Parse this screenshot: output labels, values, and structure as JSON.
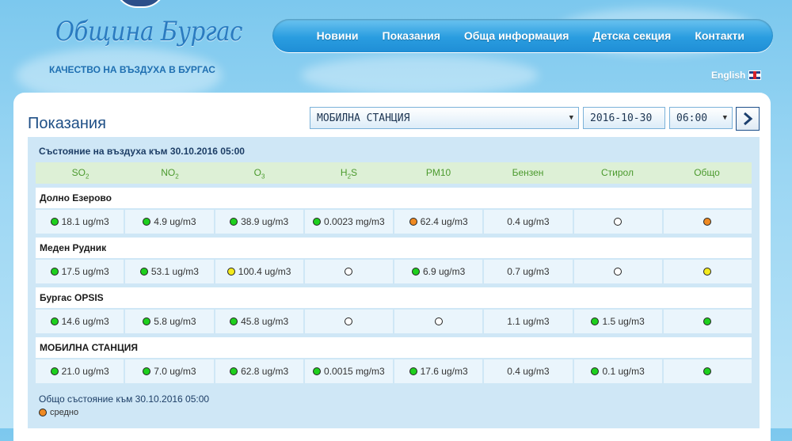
{
  "header": {
    "logo_title": "Община Бургас",
    "tagline": "КАЧЕСТВО НА ВЪЗДУХА В БУРГАС",
    "nav": [
      "Новини",
      "Показания",
      "Обща информация",
      "Детска секция",
      "Контакти"
    ],
    "language": "English"
  },
  "page": {
    "title": "Показания",
    "station_select": "МОБИЛНА СТАНЦИЯ",
    "date_value": "2016-10-30",
    "time_select": "06:00"
  },
  "table": {
    "status_heading": "Състояние на въздуха към 30.10.2016 05:00",
    "columns": [
      {
        "name": "SO",
        "sub": "2"
      },
      {
        "name": "NO",
        "sub": "2"
      },
      {
        "name": "O",
        "sub": "3"
      },
      {
        "name": "H",
        "sub": "2",
        "tail": "S"
      },
      {
        "name": "PM10",
        "sub": ""
      },
      {
        "name": "Бензен",
        "sub": ""
      },
      {
        "name": "Стирол",
        "sub": ""
      },
      {
        "name": "Общо",
        "sub": ""
      }
    ],
    "stations": [
      {
        "name": "Долно Езерово",
        "cells": [
          {
            "status": "green",
            "value": "18.1 ug/m3"
          },
          {
            "status": "green",
            "value": "4.9 ug/m3"
          },
          {
            "status": "green",
            "value": "38.9 ug/m3"
          },
          {
            "status": "green",
            "value": "0.0023 mg/m3"
          },
          {
            "status": "orange",
            "value": "62.4 ug/m3"
          },
          {
            "status": "",
            "value": "0.4 ug/m3"
          },
          {
            "status": "white",
            "value": ""
          },
          {
            "status": "orange",
            "value": ""
          }
        ]
      },
      {
        "name": "Меден Рудник",
        "cells": [
          {
            "status": "green",
            "value": "17.5 ug/m3"
          },
          {
            "status": "green",
            "value": "53.1 ug/m3"
          },
          {
            "status": "yellow",
            "value": "100.4 ug/m3"
          },
          {
            "status": "white",
            "value": ""
          },
          {
            "status": "green",
            "value": "6.9 ug/m3"
          },
          {
            "status": "",
            "value": "0.7 ug/m3"
          },
          {
            "status": "white",
            "value": ""
          },
          {
            "status": "yellow",
            "value": ""
          }
        ]
      },
      {
        "name": "Бургас OPSIS",
        "cells": [
          {
            "status": "green",
            "value": "14.6 ug/m3"
          },
          {
            "status": "green",
            "value": "5.8 ug/m3"
          },
          {
            "status": "green",
            "value": "45.8 ug/m3"
          },
          {
            "status": "white",
            "value": ""
          },
          {
            "status": "white",
            "value": ""
          },
          {
            "status": "",
            "value": "1.1 ug/m3"
          },
          {
            "status": "green",
            "value": "1.5 ug/m3"
          },
          {
            "status": "green",
            "value": ""
          }
        ]
      },
      {
        "name": "МОБИЛНА СТАНЦИЯ",
        "cells": [
          {
            "status": "green",
            "value": "21.0 ug/m3"
          },
          {
            "status": "green",
            "value": "7.0 ug/m3"
          },
          {
            "status": "green",
            "value": "62.8 ug/m3"
          },
          {
            "status": "green",
            "value": "0.0015 mg/m3"
          },
          {
            "status": "green",
            "value": "17.6 ug/m3"
          },
          {
            "status": "",
            "value": "0.4 ug/m3"
          },
          {
            "status": "green",
            "value": "0.1 ug/m3"
          },
          {
            "status": "green",
            "value": ""
          }
        ]
      }
    ]
  },
  "summary": {
    "text": "Общо състояние към 30.10.2016 05:00",
    "legend_status": "orange",
    "legend_label": "средно"
  },
  "colors": {
    "green": "#1ed01e",
    "orange": "#ef8a22",
    "yellow": "#f3ea1d",
    "white": "#ffffff",
    "header_blue": "#2a9de0"
  },
  "icons": {
    "go_button": "chevron-right-icon",
    "flag": "uk-flag-icon"
  }
}
